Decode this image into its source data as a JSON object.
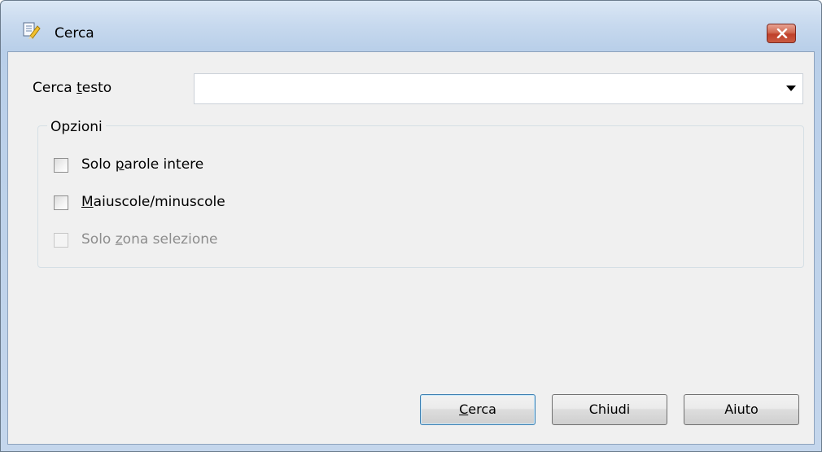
{
  "window": {
    "title": "Cerca",
    "app_icon": "search-app-icon",
    "close_icon": "close-icon"
  },
  "search": {
    "label_prefix": "Cerca ",
    "label_accel": "t",
    "label_suffix": "esto",
    "value": "",
    "dropdown_icon": "chevron-down-icon"
  },
  "options": {
    "legend": "Opzioni",
    "items": [
      {
        "pre": "Solo ",
        "accel": "p",
        "post": "arole intere",
        "checked": false,
        "enabled": true
      },
      {
        "pre": "",
        "accel": "M",
        "post": "aiuscole/minuscole",
        "checked": false,
        "enabled": true
      },
      {
        "pre": "Solo ",
        "accel": "z",
        "post": "ona selezione",
        "checked": false,
        "enabled": false
      }
    ]
  },
  "buttons": {
    "search_accel": "C",
    "search_rest": "erca",
    "close": "Chiudi",
    "help": "Aiuto"
  },
  "colors": {
    "title_bar": "#c7d9ee",
    "close_button": "#c0402a",
    "dialog_background": "#f0f0f0",
    "default_button_border": "#3c7fb1",
    "disabled_text": "#8d8d8d"
  }
}
